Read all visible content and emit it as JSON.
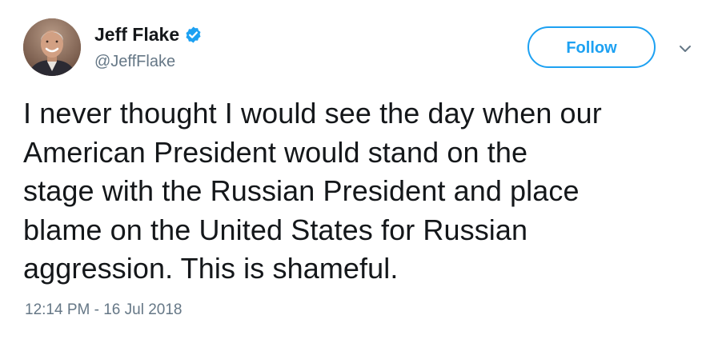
{
  "user": {
    "display_name": "Jeff Flake",
    "handle": "@JeffFlake",
    "verified": true
  },
  "actions": {
    "follow_label": "Follow"
  },
  "tweet": {
    "lines": [
      "I never thought I would see the day when our",
      "American President would stand on the",
      "stage with the Russian President and place",
      "blame on the United States for Russian",
      "aggression. This is shameful."
    ],
    "timestamp": "12:14 PM - 16 Jul 2018"
  },
  "icons": {
    "avatar": "profile-photo",
    "verified": "verified-badge-icon",
    "menu": "chevron-down-icon"
  },
  "colors": {
    "accent": "#1da1f2",
    "text": "#14171a",
    "secondary": "#657786"
  }
}
